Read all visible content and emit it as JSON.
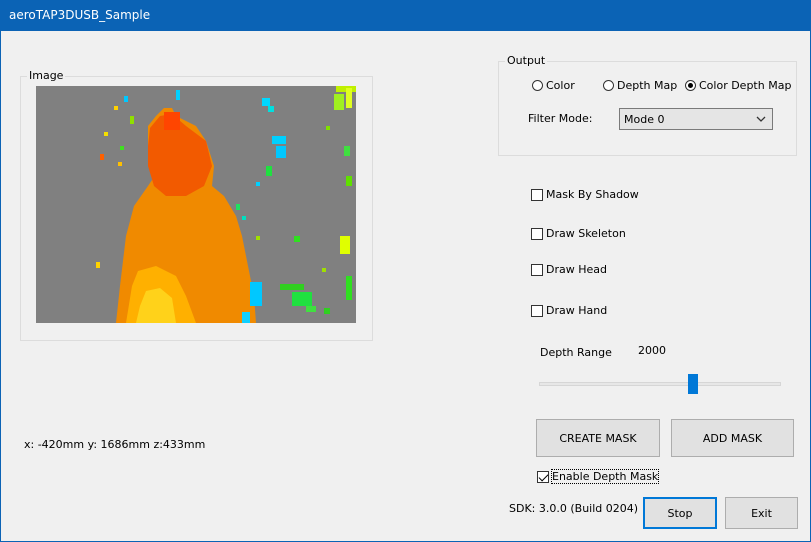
{
  "window": {
    "title": "aeroTAP3DUSB_Sample"
  },
  "image_group": {
    "legend": "Image"
  },
  "output_group": {
    "legend": "Output",
    "options": [
      {
        "label": "Color",
        "selected": false
      },
      {
        "label": "Depth Map",
        "selected": false
      },
      {
        "label": "Color Depth Map",
        "selected": true
      }
    ]
  },
  "filter": {
    "label": "Filter Mode:",
    "value": "Mode 0"
  },
  "checks": {
    "mask_by_shadow": {
      "label": "Mask By Shadow",
      "checked": false
    },
    "draw_skeleton": {
      "label": "Draw Skeleton",
      "checked": false
    },
    "draw_head": {
      "label": "Draw Head",
      "checked": false
    },
    "draw_hand": {
      "label": "Draw Hand",
      "checked": false
    },
    "enable_depth_mask": {
      "label": "Enable Depth Mask",
      "checked": true
    }
  },
  "depth_range": {
    "label": "Depth Range",
    "value": "2000"
  },
  "buttons": {
    "create_mask": "CREATE MASK",
    "add_mask": "ADD MASK",
    "stop": "Stop",
    "exit": "Exit"
  },
  "coords": "x: -420mm y: 1686mm z:433mm",
  "sdk": "SDK: 3.0.0 (Build 0204)",
  "colors": {
    "title_bar": "#0b63b5",
    "background": "#808080",
    "accent": "#0078d7"
  }
}
